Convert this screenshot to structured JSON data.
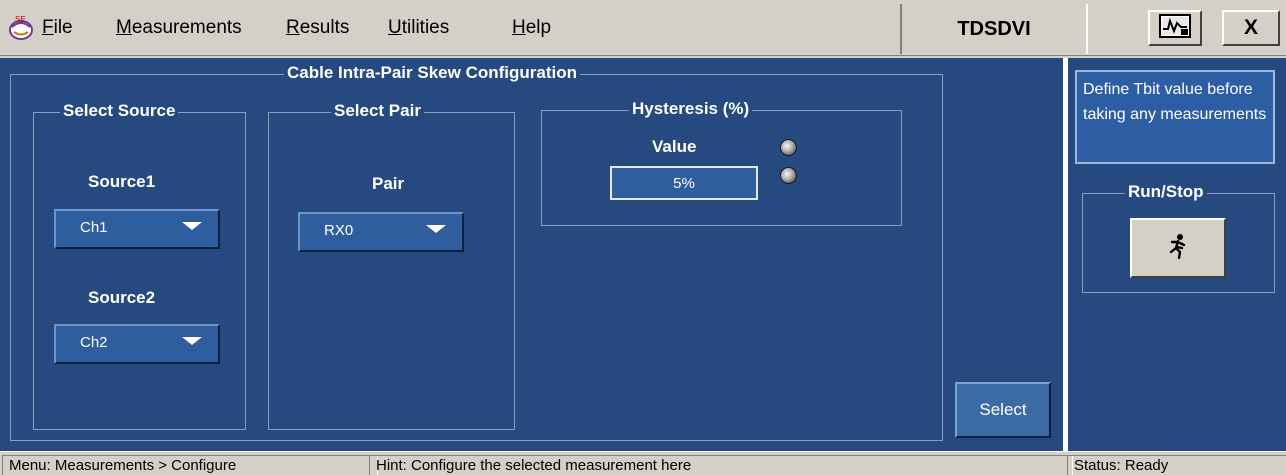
{
  "menubar": {
    "app_icon": "tektronix-app-icon",
    "items": [
      {
        "prefix": "",
        "underline": "F",
        "rest": "ile"
      },
      {
        "prefix": "",
        "underline": "M",
        "rest": "easurements"
      },
      {
        "prefix": "",
        "underline": "R",
        "rest": "esults"
      },
      {
        "prefix": "",
        "underline": "U",
        "rest": "tilities"
      },
      {
        "prefix": "",
        "underline": "H",
        "rest": "elp"
      }
    ],
    "title": "TDSDVI",
    "scope_icon": "scope-waveform-icon",
    "close_label": "X"
  },
  "config": {
    "title": "Cable Intra-Pair Skew Configuration",
    "source_group": {
      "title": "Select Source",
      "source1_label": "Source1",
      "source1_value": "Ch1",
      "source2_label": "Source2",
      "source2_value": "Ch2"
    },
    "pair_group": {
      "title": "Select Pair",
      "pair_label": "Pair",
      "pair_value": "RX0"
    },
    "hysteresis_group": {
      "title": "Hysteresis (%)",
      "value_label": "Value",
      "value": "5%"
    },
    "select_label": "Select"
  },
  "side": {
    "hint_text": "Define Tbit value before taking any measurements",
    "run_group_title": "Run/Stop",
    "run_icon": "running-man-icon"
  },
  "statusbar": {
    "menu": "Menu: Measurements > Configure",
    "hint": "Hint: Configure the selected measurement here",
    "status": "Status: Ready"
  },
  "colors": {
    "panel": "#264a7f",
    "chrome": "#d4d0c8",
    "control": "#2f5e9e"
  }
}
